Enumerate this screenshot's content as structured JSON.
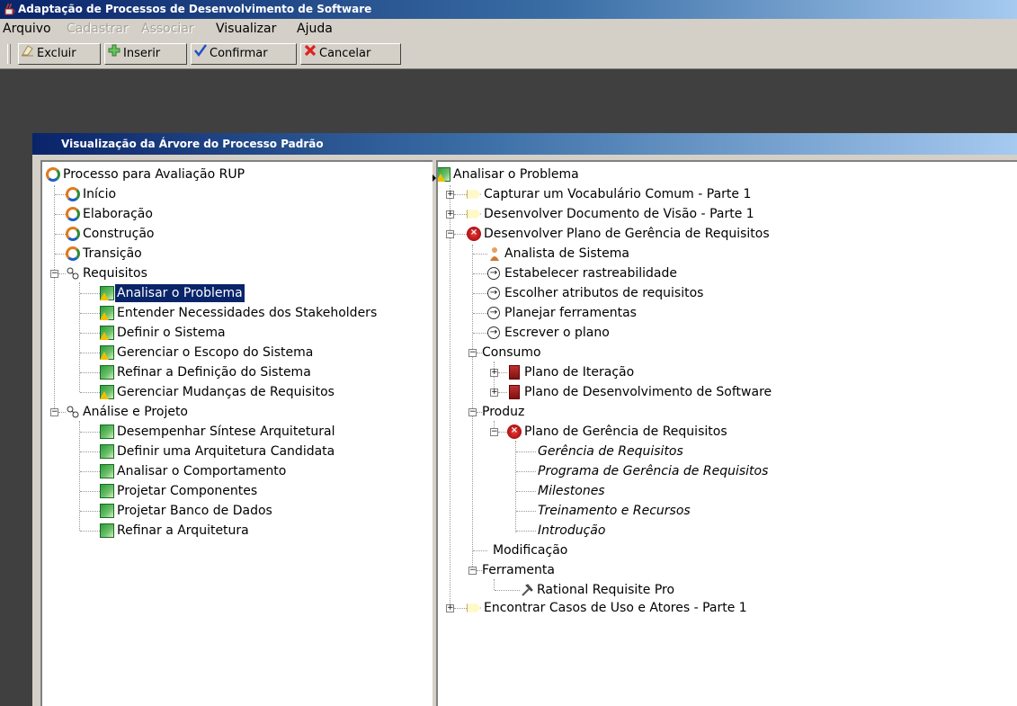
{
  "window": {
    "title": "Adaptação de Processos de Desenvolvimento de Software"
  },
  "menubar": {
    "items": [
      {
        "label": "Arquivo",
        "enabled": true
      },
      {
        "label": "Cadastrar",
        "enabled": false
      },
      {
        "label": "Associar",
        "enabled": false
      },
      {
        "label": "Visualizar",
        "enabled": true
      },
      {
        "label": "Ajuda",
        "enabled": true
      }
    ]
  },
  "toolbar": {
    "buttons": [
      {
        "label": "Excluir",
        "icon": "eraser-icon"
      },
      {
        "label": "Inserir",
        "icon": "plus-icon"
      },
      {
        "label": "Confirmar",
        "icon": "checkmark-icon"
      },
      {
        "label": "Cancelar",
        "icon": "red-x-icon"
      }
    ]
  },
  "internal_frame": {
    "title": "Visualização da Árvore do Processo Padrão"
  },
  "left_tree": {
    "root": "Processo para Avaliação RUP",
    "phases": [
      "Início",
      "Elaboração",
      "Construção",
      "Transição"
    ],
    "disciplines": [
      {
        "label": "Requisitos",
        "expanded": true,
        "workflows": [
          {
            "label": "Analisar o Problema",
            "warning": true,
            "selected": true
          },
          {
            "label": "Entender Necessidades dos Stakeholders",
            "warning": true
          },
          {
            "label": "Definir o Sistema",
            "warning": true
          },
          {
            "label": "Gerenciar o Escopo do Sistema",
            "warning": true
          },
          {
            "label": "Refinar a Definição do Sistema",
            "warning": false
          },
          {
            "label": "Gerenciar Mudanças de Requisitos",
            "warning": true
          }
        ]
      },
      {
        "label": "Análise e Projeto",
        "expanded": true,
        "workflows": [
          {
            "label": "Desempenhar Síntese Arquitetural"
          },
          {
            "label": "Definir uma Arquitetura Candidata"
          },
          {
            "label": "Analisar o Comportamento"
          },
          {
            "label": "Projetar Componentes"
          },
          {
            "label": "Projetar Banco de Dados"
          },
          {
            "label": "Refinar a Arquitetura"
          }
        ]
      }
    ]
  },
  "right_tree": {
    "root": "Analisar o Problema",
    "activities": [
      "Capturar um Vocabulário Comum - Parte 1",
      "Desenvolver Documento de Visão - Parte 1",
      "Desenvolver Plano de Gerência de Requisitos",
      "Encontrar Casos de Uso e Atores - Parte 1"
    ],
    "role": "Analista de Sistema",
    "steps": [
      "Estabelecer rastreabilidade",
      "Escolher atributos de requisitos",
      "Planejar ferramentas",
      "Escrever o plano"
    ],
    "consumo": {
      "label": "Consumo",
      "items": [
        "Plano de Iteração",
        "Plano de Desenvolvimento de Software"
      ]
    },
    "produz": {
      "label": "Produz",
      "artifact": "Plano de Gerência de Requisitos",
      "sections": [
        "Gerência de Requisitos",
        "Programa de Gerência de Requisitos",
        "Milestones",
        "Treinamento e Recursos",
        "Introdução"
      ]
    },
    "modificacao": "Modificação",
    "ferramenta": {
      "label": "Ferramenta",
      "tool": "Rational Requisite Pro"
    }
  },
  "colors": {
    "title_bar": "#0a246a",
    "selection": "#0a246a",
    "desktop": "#404040",
    "chrome": "#d4d0c8"
  }
}
